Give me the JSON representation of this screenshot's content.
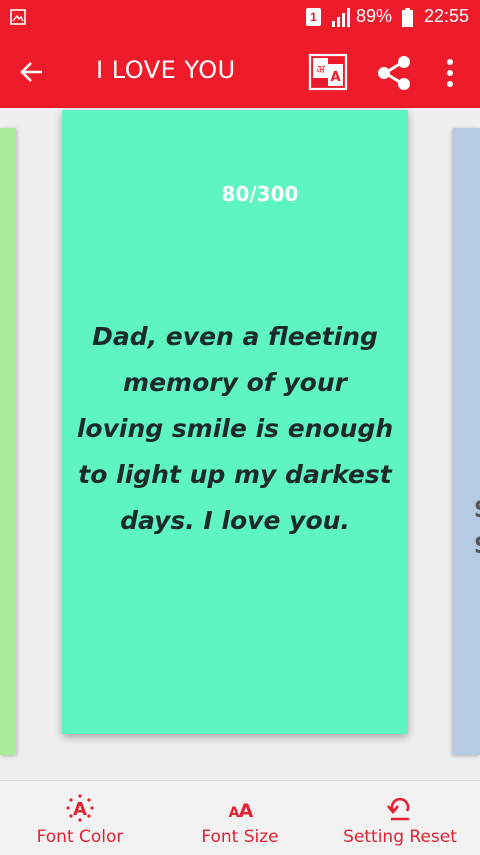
{
  "status_bar": {
    "sim": "1",
    "battery_text": "89%",
    "time": "22:55"
  },
  "toolbar": {
    "title": "I LOVE YOU",
    "icons": [
      "back-arrow-icon",
      "translate-icon",
      "share-icon",
      "more-vert-icon"
    ]
  },
  "card": {
    "counter": "80/300",
    "quote_lines": [
      "Dad, even a fleeting",
      "memory of your",
      "loving smile is enough",
      "to light up my darkest",
      "days. I love you."
    ],
    "background": "#5ff5c0"
  },
  "right_card": {
    "peek_chars": [
      "S",
      "S"
    ]
  },
  "bottom_bar": {
    "items": [
      {
        "label": "Font Color",
        "icon": "font-color-icon"
      },
      {
        "label": "Font Size",
        "icon": "font-size-icon"
      },
      {
        "label": "Setting Reset",
        "icon": "reset-icon"
      }
    ]
  },
  "colors": {
    "accent": "#ee1c2b",
    "bottom_accent": "#e32132",
    "left_card": "#a9ec9a",
    "right_card": "#b4cbe3"
  }
}
